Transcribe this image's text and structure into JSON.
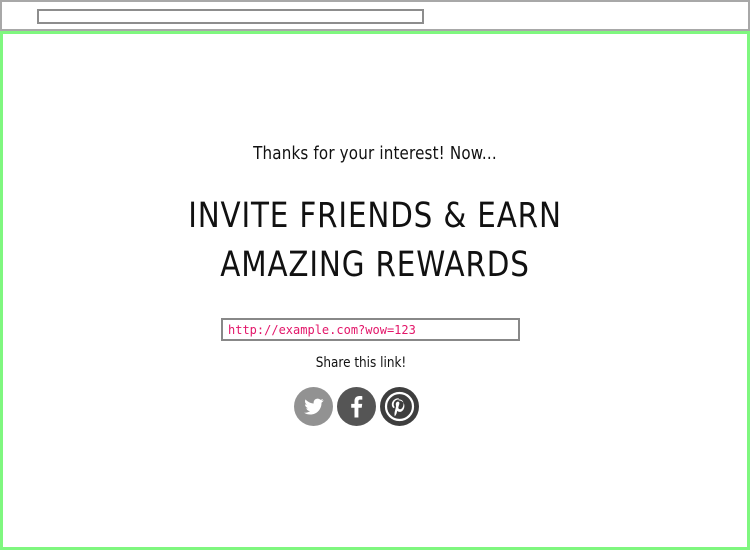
{
  "browser": {
    "address": ""
  },
  "main": {
    "intro": "Thanks for your interest! Now...",
    "headline_line_1": "INVITE FRIENDS & EARN",
    "headline_line_2": "AMAZING REWARDS",
    "share_url": "http://example.com?wow=123",
    "share_caption": "Share this link!"
  },
  "social": [
    {
      "name": "twitter-icon",
      "color": "#929292"
    },
    {
      "name": "facebook-icon",
      "color": "#555555"
    },
    {
      "name": "pinterest-icon",
      "color": "#3e3e3e"
    }
  ],
  "colors": {
    "frame_border": "#7ff77f",
    "link_text": "#e31669"
  }
}
